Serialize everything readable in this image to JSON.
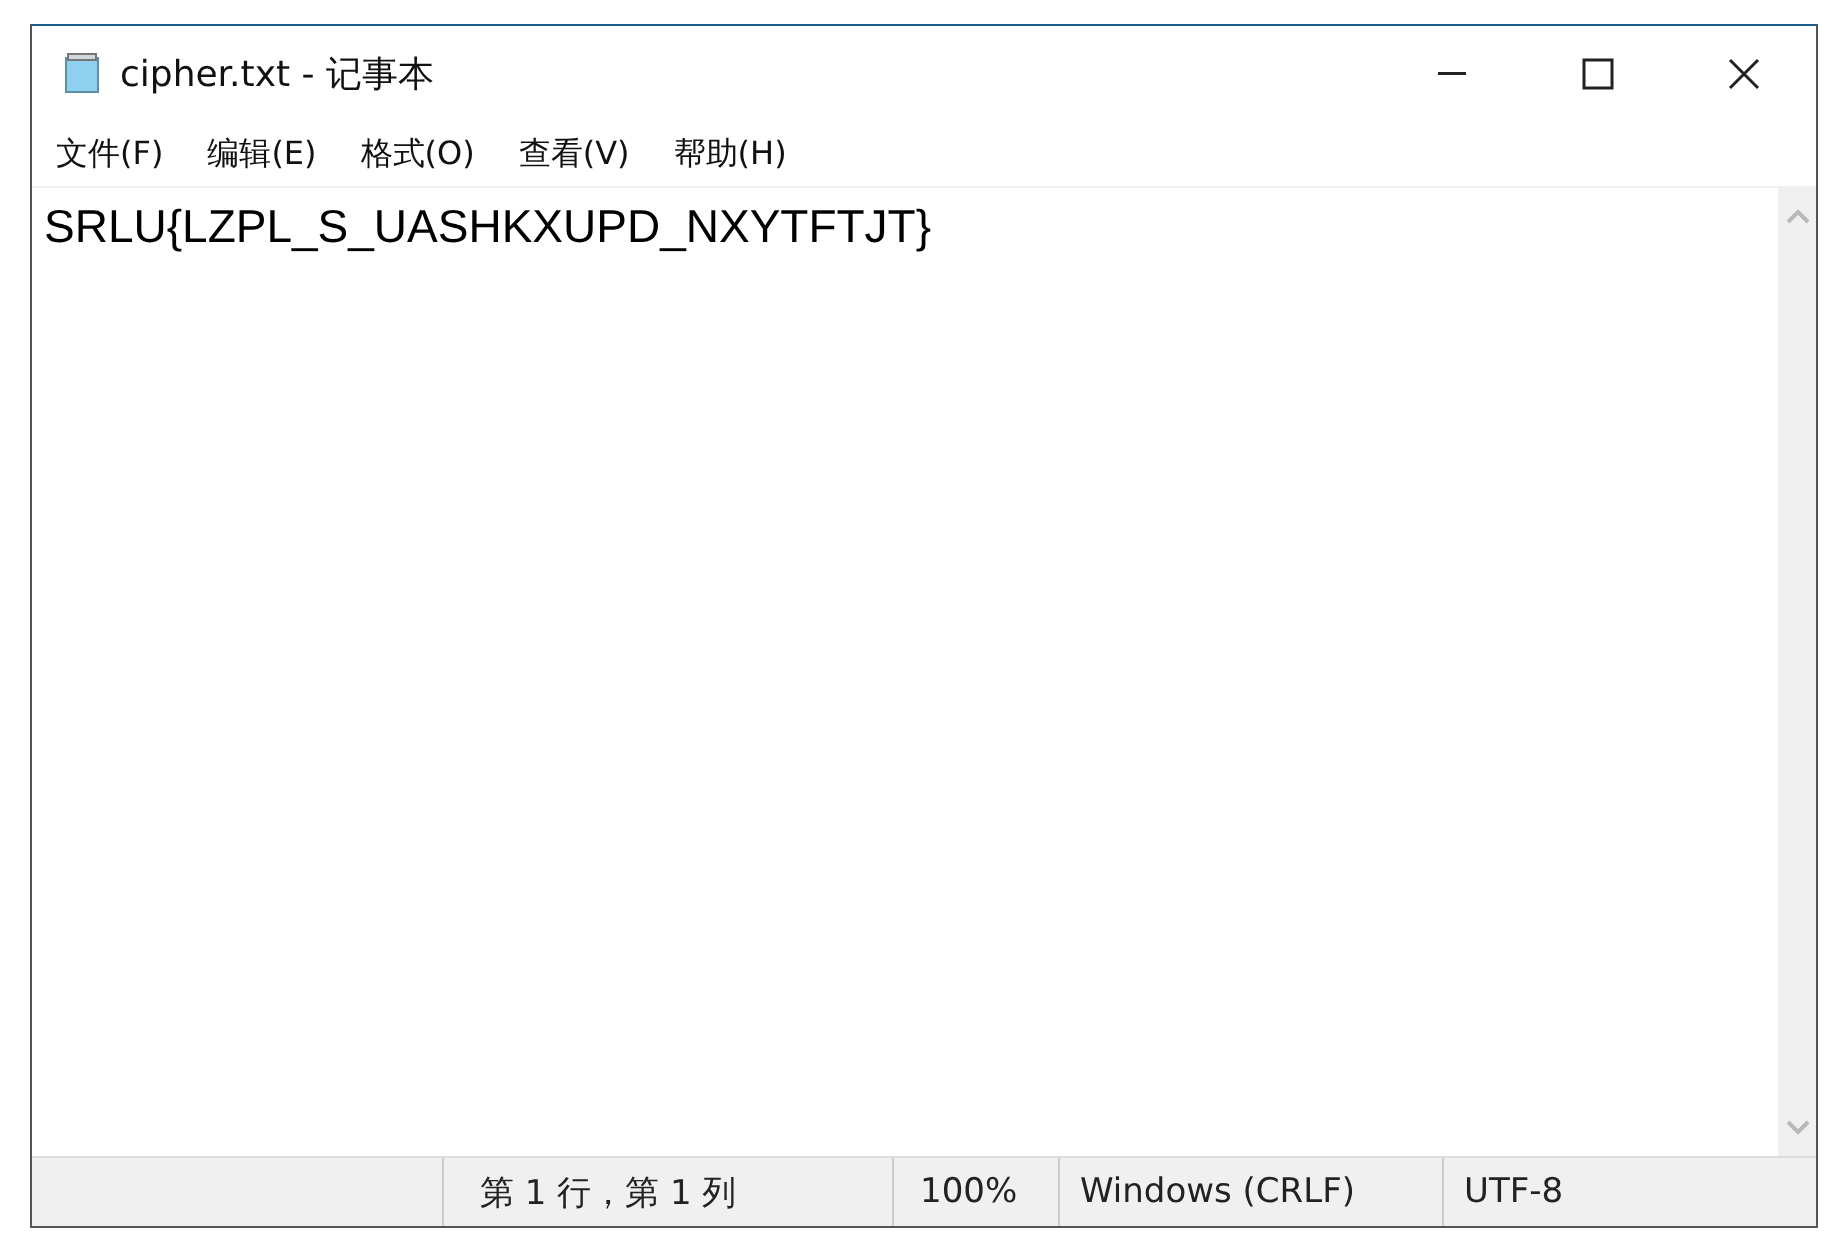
{
  "window": {
    "title": "cipher.txt - 记事本"
  },
  "menu": [
    "文件(F)",
    "编辑(E)",
    "格式(O)",
    "查看(V)",
    "帮助(H)"
  ],
  "editor": {
    "text": "SRLU{LZPL_S_UASHKXUPD_NXYTFTJT}"
  },
  "status_bar": [
    "第 1 行，第 1 列",
    "100%",
    "Windows (CRLF)",
    "UTF-8"
  ]
}
